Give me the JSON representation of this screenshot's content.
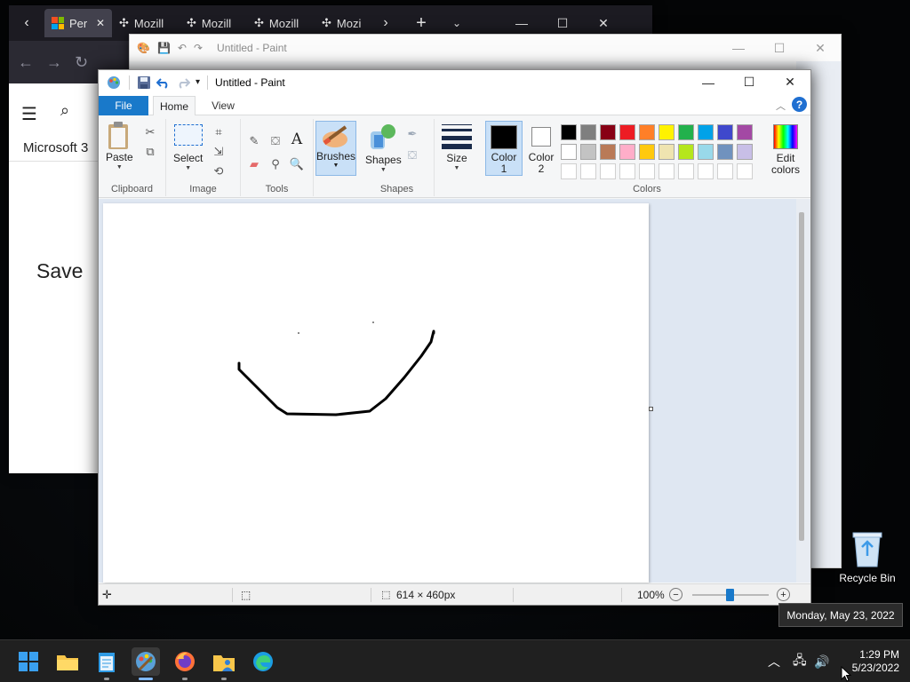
{
  "browser": {
    "tabs": [
      "Per",
      "Mozill",
      "Mozill",
      "Mozill",
      "Mozi"
    ],
    "site_name": "Microsoft 3",
    "page_text": "Save"
  },
  "paint_back": {
    "title": "Untitled - Paint"
  },
  "paint": {
    "title": "Untitled - Paint",
    "tabs": {
      "file": "File",
      "home": "Home",
      "view": "View"
    },
    "help": "?",
    "groups": {
      "clipboard": "Clipboard",
      "image": "Image",
      "tools": "Tools",
      "shapes": "Shapes",
      "colors": "Colors"
    },
    "buttons": {
      "paste": "Paste",
      "select": "Select",
      "brushes": "Brushes",
      "shapes": "Shapes",
      "size": "Size",
      "color1_line1": "Color",
      "color1_line2": "1",
      "color2_line1": "Color",
      "color2_line2": "2",
      "edit_colors_line1": "Edit",
      "edit_colors_line2": "colors"
    },
    "colors": {
      "color1": "#000000",
      "color2": "#ffffff",
      "palette_row1": [
        "#000000",
        "#7f7f7f",
        "#880015",
        "#ed1c24",
        "#ff7f27",
        "#fff200",
        "#22b14c",
        "#00a2e8",
        "#3f48cc",
        "#a349a4"
      ],
      "palette_row2": [
        "#ffffff",
        "#c3c3c3",
        "#b97a57",
        "#ffaec9",
        "#ffc90e",
        "#efe4b0",
        "#b5e61d",
        "#99d9ea",
        "#7092be",
        "#c8bfe7"
      ],
      "palette_row3": [
        "#ffffff",
        "#ffffff",
        "#ffffff",
        "#ffffff",
        "#ffffff",
        "#ffffff",
        "#ffffff",
        "#ffffff",
        "#ffffff",
        "#ffffff"
      ]
    },
    "status": {
      "canvas_size": "614 × 460px",
      "zoom": "100%"
    }
  },
  "desktop": {
    "recycle_bin": "Recycle Bin"
  },
  "tooltip": "Monday, May 23, 2022",
  "taskbar": {
    "time": "1:29 PM",
    "date": "5/23/2022"
  }
}
